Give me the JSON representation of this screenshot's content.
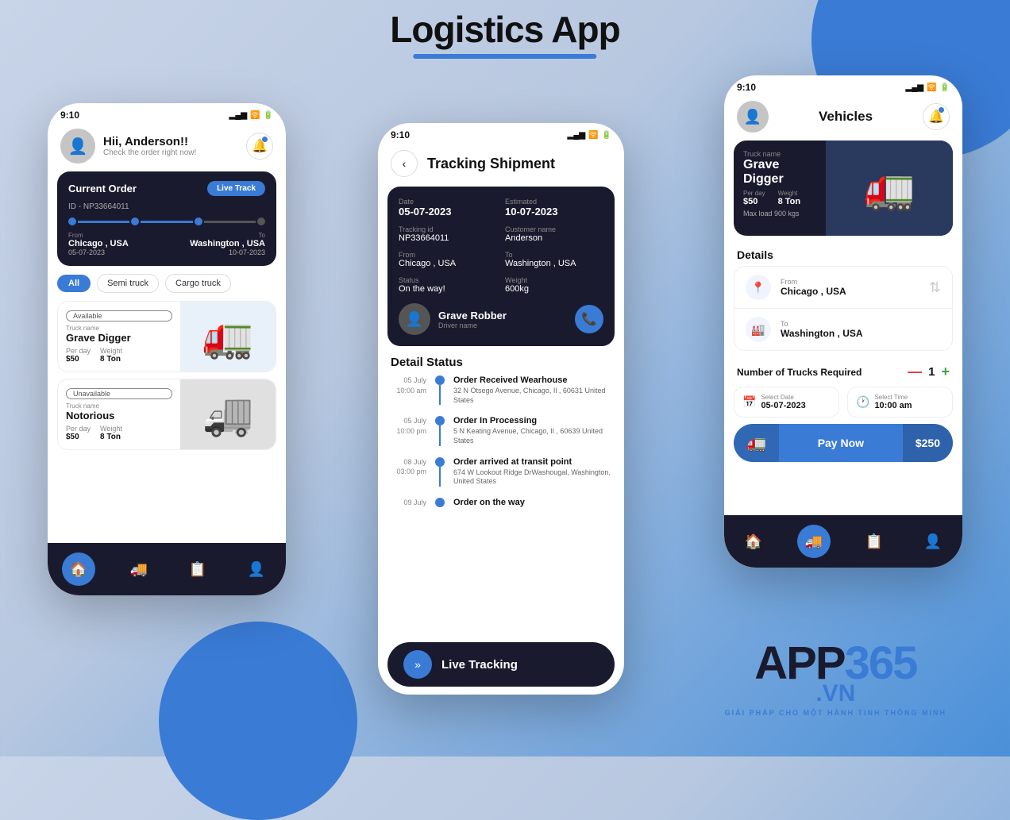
{
  "page": {
    "title": "Logistics App",
    "subtitle": "9:10 Tracking Shipment",
    "background_color": "#c8d4e8"
  },
  "phone1": {
    "status_bar": {
      "time": "9:10"
    },
    "header": {
      "greeting": "Hii, Anderson!!",
      "sub": "Check the order right now!",
      "bell_label": "notification bell"
    },
    "order_card": {
      "title": "Current Order",
      "live_track_btn": "Live Track",
      "order_id": "ID - NP33664011",
      "from": "Chicago , USA",
      "from_date": "05-07-2023",
      "to": "Washington , USA",
      "to_date": "10-07-2023"
    },
    "filters": [
      "All",
      "Semi truck",
      "Cargo truck"
    ],
    "trucks": [
      {
        "status": "Available",
        "name": "Grave Digger",
        "per_day_label": "Per day",
        "per_day": "$50",
        "weight_label": "Weight",
        "weight": "8 Ton",
        "color": "blue"
      },
      {
        "status": "Unavailable",
        "name": "Notorious",
        "per_day_label": "Per day",
        "per_day": "$50",
        "weight_label": "Weight",
        "weight": "8 Ton",
        "color": "white"
      }
    ],
    "nav": [
      "home",
      "delivery",
      "list",
      "person"
    ]
  },
  "phone2": {
    "status_bar": {
      "time": "9:10"
    },
    "title": "Tracking Shipment",
    "back_label": "back",
    "shipment": {
      "date_label": "Date",
      "date": "05-07-2023",
      "estimated_label": "Estimated",
      "estimated": "10-07-2023",
      "tracking_id_label": "Tracking id",
      "tracking_id": "NP33664011",
      "customer_label": "Customer name",
      "customer": "Anderson",
      "from_label": "From",
      "from": "Chicago , USA",
      "to_label": "To",
      "to": "Washington , USA",
      "status_label": "Status",
      "status": "On the way!",
      "weight_label": "Weight",
      "weight": "600kg",
      "driver_name": "Grave Robber",
      "driver_role": "Driver name"
    },
    "detail_status_title": "Detail Status",
    "timeline": [
      {
        "date": "05 July",
        "time": "10:00 am",
        "event": "Order Received Wearhouse",
        "address": "32 N Otsego Avenue, Chicago, Il , 60631 United States"
      },
      {
        "date": "05 July",
        "time": "10:00 pm",
        "event": "Order In Processing",
        "address": "5 N Keating Avenue, Chicago, Il , 60639 United States"
      },
      {
        "date": "08 July",
        "time": "03:00 pm",
        "event": "Order arrived at transit point",
        "address": "674 W Lookout Ridge DrWashougal, Washington, United States"
      },
      {
        "date": "09 July",
        "time": "",
        "event": "Order on the way",
        "address": ""
      }
    ],
    "live_tracking_btn": "Live Tracking"
  },
  "phone3": {
    "status_bar": {
      "time": "9:10"
    },
    "title": "Vehicles",
    "vehicle": {
      "truck_name_label": "Truck name",
      "truck_name": "Grave Digger",
      "per_day_label": "Per day",
      "per_day": "$50",
      "weight_label": "Weight",
      "weight": "8 Ton",
      "max_load": "Max load 900 kgs"
    },
    "details_title": "Details",
    "from_label": "From",
    "from": "Chicago , USA",
    "to_label": "To",
    "to": "Washington , USA",
    "trucks_required_label": "Number of Trucks Required",
    "trucks_count": "1",
    "date_label": "Select Date",
    "date": "05-07-2023",
    "time_label": "Select Time",
    "time": "10:00 am",
    "pay_btn": "Pay Now",
    "price": "$250",
    "nav": [
      "home",
      "delivery",
      "list",
      "person"
    ]
  },
  "app365": {
    "app_text": "APP",
    "num_text": "365",
    "dot_vn": ".VN",
    "tagline": "GIẢI PHÁP CHO MỘT HÀNH TINH THÔNG MINH"
  }
}
